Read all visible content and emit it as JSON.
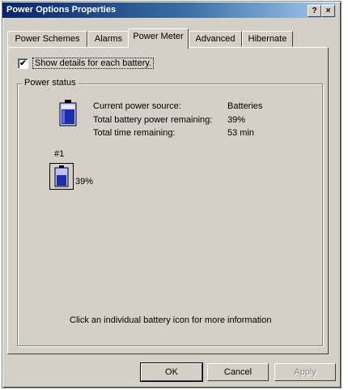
{
  "window": {
    "title": "Power Options Properties",
    "help_btn": "?",
    "close_btn": "×"
  },
  "tabs": [
    {
      "label": "Power Schemes"
    },
    {
      "label": "Alarms"
    },
    {
      "label": "Power Meter"
    },
    {
      "label": "Advanced"
    },
    {
      "label": "Hibernate"
    }
  ],
  "show_details": {
    "label": "Show details for each battery.",
    "checked_mark": "✔"
  },
  "power_status": {
    "group_title": "Power status",
    "rows": [
      {
        "label": "Current power source:",
        "value": "Batteries"
      },
      {
        "label": "Total battery power remaining:",
        "value": "39%"
      },
      {
        "label": "Total time remaining:",
        "value": "53 min"
      }
    ],
    "battery_number": "#1",
    "battery_percent": "39%",
    "battery_level": 0.39,
    "hint": "Click an individual battery icon for more information"
  },
  "buttons": {
    "ok": "OK",
    "cancel": "Cancel",
    "apply": "Apply"
  },
  "colors": {
    "titlebar_start": "#0a246a",
    "titlebar_end": "#a6caf0",
    "dialog_bg": "#d4d0c8",
    "battery_blue": "#1c2fa8"
  }
}
